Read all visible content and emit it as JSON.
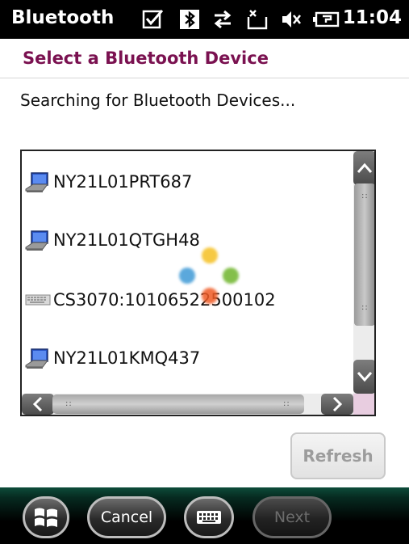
{
  "status_bar": {
    "title": "Bluetooth",
    "time": "11:04",
    "icons": [
      "checkbox-icon",
      "bluetooth-icon",
      "data-transfer-icon",
      "message-icon",
      "volume-mute-icon",
      "battery-charging-icon"
    ]
  },
  "header": {
    "title": "Select a Bluetooth Device"
  },
  "status_text": "Searching for Bluetooth Devices...",
  "devices": [
    {
      "name": "NY21L01PRT687",
      "icon": "computer-icon"
    },
    {
      "name": "NY21L01QTGH48",
      "icon": "computer-icon"
    },
    {
      "name": "CS3070:10106522500102",
      "icon": "keyboard-icon"
    },
    {
      "name": "NY21L01KMQ437",
      "icon": "computer-icon"
    }
  ],
  "buttons": {
    "refresh": "Refresh",
    "cancel": "Cancel",
    "next": "Next"
  },
  "colors": {
    "header_title": "#7a1150",
    "accent_bar": "#0d4c3a"
  }
}
